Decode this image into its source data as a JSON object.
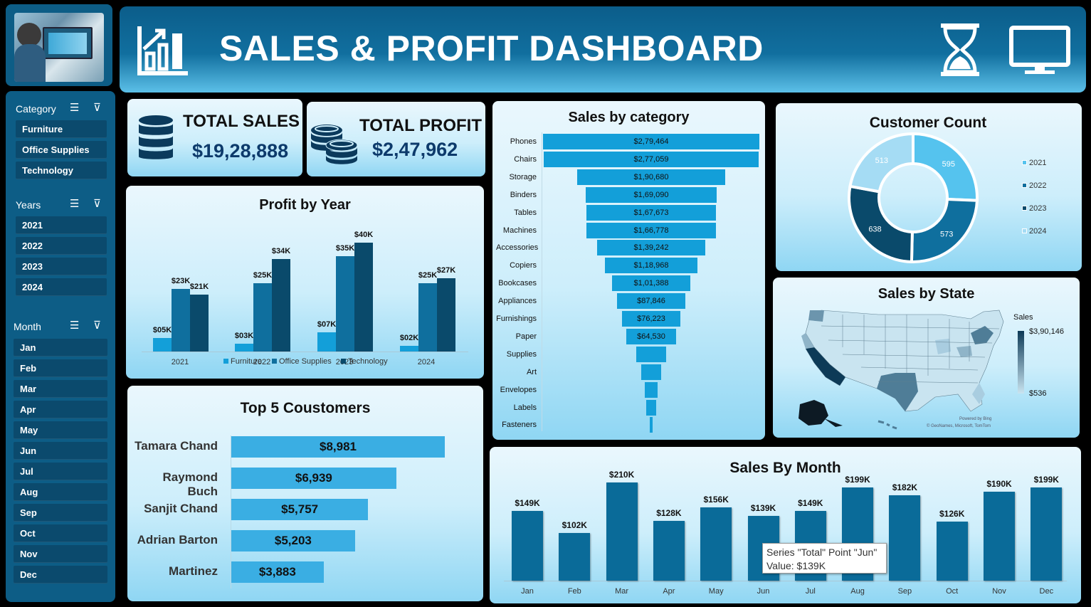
{
  "header": {
    "title": "SALES & PROFIT DASHBOARD",
    "icons": [
      "bar-chart-growth-icon",
      "hourglass-icon",
      "monitor-icon"
    ]
  },
  "slicers": {
    "category": {
      "label": "Category",
      "items": [
        "Furniture",
        "Office Supplies",
        "Technology"
      ]
    },
    "years": {
      "label": "Years",
      "items": [
        "2021",
        "2022",
        "2023",
        "2024"
      ]
    },
    "month": {
      "label": "Month",
      "items": [
        "Jan",
        "Feb",
        "Mar",
        "Apr",
        "May",
        "Jun",
        "Jul",
        "Aug",
        "Sep",
        "Oct",
        "Nov",
        "Dec"
      ]
    }
  },
  "kpis": {
    "total_sales": {
      "label": "TOTAL SALES",
      "value": "$19,28,888"
    },
    "total_profit": {
      "label": "TOTAL PROFIT",
      "value": "$2,47,962"
    }
  },
  "profit_by_year": {
    "title": "Profit by Year",
    "years": [
      "2021",
      "2022",
      "2023",
      "2024"
    ],
    "series": [
      {
        "name": "Furniture",
        "values": [
          5,
          3,
          7,
          2
        ],
        "labels": [
          "$05K",
          "$03K",
          "$07K",
          "$02K"
        ],
        "color": "#139fd9"
      },
      {
        "name": "Office Supplies",
        "values": [
          23,
          25,
          35,
          25
        ],
        "labels": [
          "$23K",
          "$25K",
          "$35K",
          "$25K"
        ],
        "color": "#0f6f9e"
      },
      {
        "name": "Technology",
        "values": [
          21,
          34,
          40,
          27
        ],
        "labels": [
          "$21K",
          "$34K",
          "$40K",
          "$27K"
        ],
        "color": "#0a4a6b"
      }
    ]
  },
  "sales_by_category": {
    "title": "Sales by category",
    "items": [
      {
        "name": "Phones",
        "value": 279464,
        "label": "$2,79,464"
      },
      {
        "name": "Chairs",
        "value": 277059,
        "label": "$2,77,059"
      },
      {
        "name": "Storage",
        "value": 190680,
        "label": "$1,90,680"
      },
      {
        "name": "Binders",
        "value": 169090,
        "label": "$1,69,090"
      },
      {
        "name": "Tables",
        "value": 167673,
        "label": "$1,67,673"
      },
      {
        "name": "Machines",
        "value": 166778,
        "label": "$1,66,778"
      },
      {
        "name": "Accessories",
        "value": 139242,
        "label": "$1,39,242"
      },
      {
        "name": "Copiers",
        "value": 118968,
        "label": "$1,18,968"
      },
      {
        "name": "Bookcases",
        "value": 101388,
        "label": "$1,01,388"
      },
      {
        "name": "Appliances",
        "value": 87846,
        "label": "$87,846"
      },
      {
        "name": "Furnishings",
        "value": 76223,
        "label": "$76,223"
      },
      {
        "name": "Paper",
        "value": 64530,
        "label": "$64,530"
      },
      {
        "name": "Supplies",
        "value": 38000,
        "label": ""
      },
      {
        "name": "Art",
        "value": 26000,
        "label": ""
      },
      {
        "name": "Envelopes",
        "value": 16000,
        "label": ""
      },
      {
        "name": "Labels",
        "value": 12000,
        "label": ""
      },
      {
        "name": "Fasteners",
        "value": 3000,
        "label": ""
      }
    ]
  },
  "customer_count": {
    "title": "Customer Count",
    "series": [
      {
        "name": "2021",
        "value": 595,
        "color": "#55c3ee"
      },
      {
        "name": "2022",
        "value": 573,
        "color": "#0f6f9e"
      },
      {
        "name": "2023",
        "value": 638,
        "color": "#0a4a6b"
      },
      {
        "name": "2024",
        "value": 513,
        "color": "#a5dcf4"
      }
    ]
  },
  "sales_by_state": {
    "title": "Sales by State",
    "legend_title": "Sales",
    "legend_max": "$3,90,146",
    "legend_min": "$536",
    "attribution_1": "Powered by Bing",
    "attribution_2": "© GeoNames, Microsoft, TomTom"
  },
  "top_customers": {
    "title": "Top 5 Coustomers",
    "items": [
      {
        "name": "Tamara Chand",
        "value": 8981,
        "label": "$8,981"
      },
      {
        "name": "Raymond Buch",
        "value": 6939,
        "label": "$6,939"
      },
      {
        "name": "Sanjit Chand",
        "value": 5757,
        "label": "$5,757"
      },
      {
        "name": "Adrian Barton",
        "value": 5203,
        "label": "$5,203"
      },
      {
        "name": "Martinez",
        "value": 3883,
        "label": "$3,883"
      }
    ]
  },
  "sales_by_month": {
    "title": "Sales By Month",
    "tooltip_line1": "Series \"Total\" Point \"Jun\"",
    "tooltip_line2": "Value: $139K"
  },
  "chart_data": [
    {
      "type": "bar",
      "title": "Profit by Year",
      "categories": [
        "2021",
        "2022",
        "2023",
        "2024"
      ],
      "series": [
        {
          "name": "Furniture",
          "values": [
            5,
            3,
            7,
            2
          ]
        },
        {
          "name": "Office Supplies",
          "values": [
            23,
            25,
            35,
            25
          ]
        },
        {
          "name": "Technology",
          "values": [
            21,
            34,
            40,
            27
          ]
        }
      ],
      "ylabel": "",
      "xlabel": ""
    },
    {
      "type": "bar",
      "title": "Sales By Month",
      "categories": [
        "Jan",
        "Feb",
        "Mar",
        "Apr",
        "May",
        "Jun",
        "Jul",
        "Aug",
        "Sep",
        "Oct",
        "Nov",
        "Dec"
      ],
      "values": [
        149,
        102,
        210,
        128,
        156,
        139,
        149,
        199,
        182,
        126,
        190,
        199
      ],
      "labels": [
        "$149K",
        "$102K",
        "$210K",
        "$128K",
        "$156K",
        "$139K",
        "$149K",
        "$199K",
        "$182K",
        "$126K",
        "$190K",
        "$199K"
      ],
      "color": "#0a6b99"
    }
  ]
}
